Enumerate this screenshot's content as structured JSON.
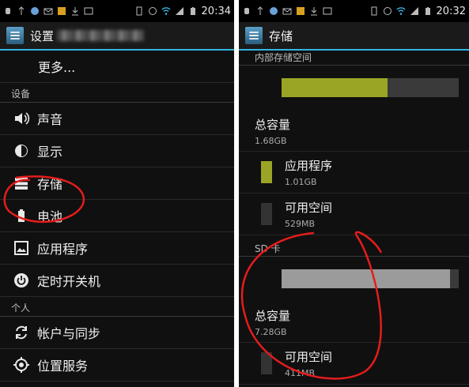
{
  "status_bar": {
    "time": "20:34",
    "time_right": "20:32"
  },
  "left": {
    "title_prefix": "设置",
    "more": "更多...",
    "section_device": "设备",
    "items": [
      {
        "label": "声音",
        "icon": "speaker-icon"
      },
      {
        "label": "显示",
        "icon": "brightness-icon"
      },
      {
        "label": "存储",
        "icon": "storage-icon"
      },
      {
        "label": "电池",
        "icon": "battery-icon"
      },
      {
        "label": "应用程序",
        "icon": "apps-icon"
      },
      {
        "label": "定时开关机",
        "icon": "power-icon"
      }
    ],
    "section_personal": "个人",
    "personal_items": [
      {
        "label": "帐户与同步",
        "icon": "sync-icon"
      },
      {
        "label": "位置服务",
        "icon": "location-icon"
      }
    ]
  },
  "right": {
    "title": "存储",
    "internal": {
      "header": "内部存储空间",
      "usage_fraction": 0.6,
      "total_label": "总容量",
      "total_value": "1.68GB",
      "apps_label": "应用程序",
      "apps_value": "1.01GB",
      "free_label": "可用空间",
      "free_value": "529MB"
    },
    "sd": {
      "header": "SD 卡",
      "usage_fraction": 0.95,
      "total_label": "总容量",
      "total_value": "7.28GB",
      "free_label": "可用空间",
      "free_value": "411MB"
    }
  },
  "colors": {
    "accent": "#33b5e5",
    "apps_bar": "#9aa526",
    "sd_bar": "#9b9b9b",
    "free": "#333333",
    "annotation": "#e51c1c"
  }
}
